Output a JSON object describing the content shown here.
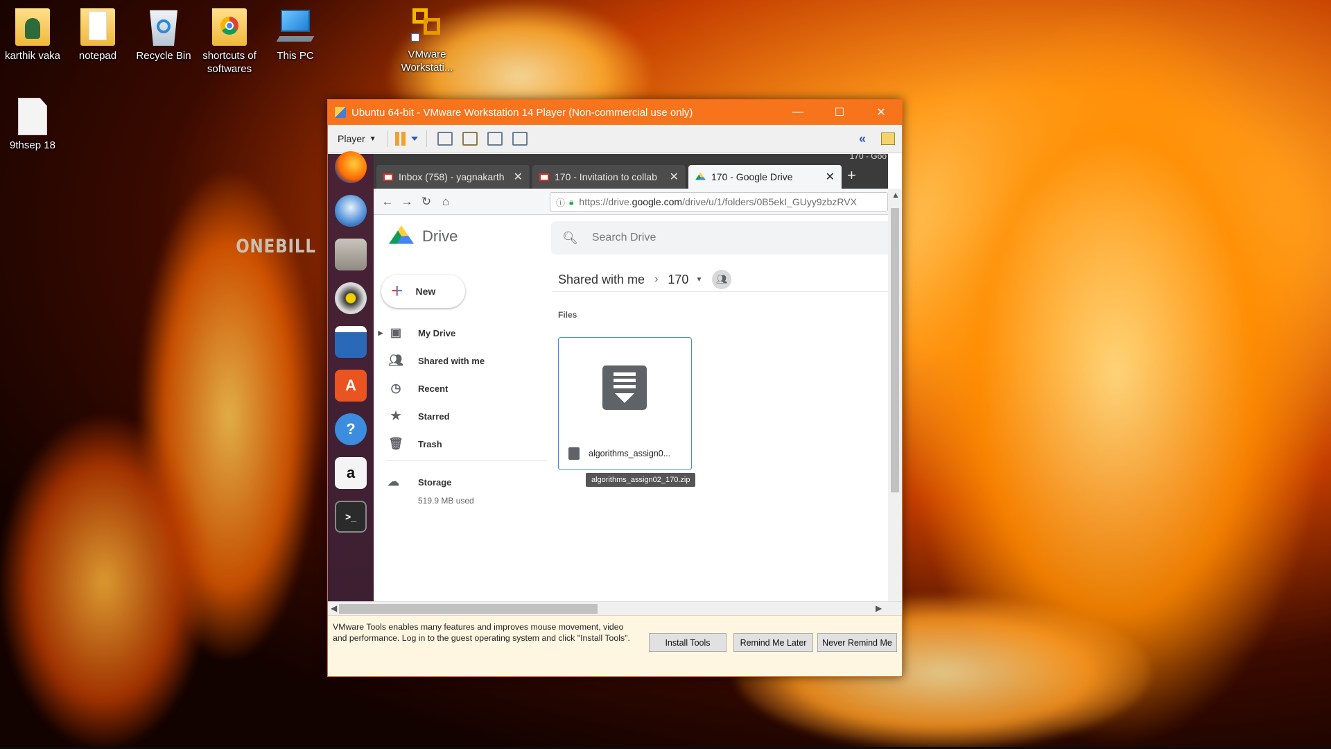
{
  "desktop": {
    "icons": [
      {
        "label": "karthik vaka",
        "icon": "user-folder-icon"
      },
      {
        "label": "notepad",
        "icon": "folder-icon"
      },
      {
        "label": "Recycle Bin",
        "icon": "recycle-bin-icon"
      },
      {
        "label": "shortcuts of softwares",
        "icon": "chrome-folder-icon"
      },
      {
        "label": "This PC",
        "icon": "computer-icon"
      },
      {
        "label": "VMware Workstati...",
        "icon": "vmware-icon"
      },
      {
        "label": "9thsep 18",
        "icon": "document-icon"
      }
    ],
    "wallpaper_text": "ONEBILL"
  },
  "vm_window": {
    "title": "Ubuntu 64-bit - VMware Workstation 14 Player (Non-commercial use only)",
    "controls": {
      "minimize": "—",
      "maximize": "☐",
      "close": "✕"
    },
    "toolbar": {
      "player_label": "Player"
    }
  },
  "browser": {
    "corner_text": "170 - Goo",
    "tabs": [
      {
        "label": "Inbox (758) - yagnakarth",
        "icon": "gmail-icon"
      },
      {
        "label": "170 - Invitation to collab",
        "icon": "gmail-icon"
      },
      {
        "label": "170 - Google Drive",
        "icon": "drive-icon",
        "active": true
      }
    ],
    "new_tab": "+",
    "url": {
      "prefix": "https://drive.",
      "host": "google.com",
      "path": "/drive/u/1/folders/0B5ekI_GUyy9zbzRVX"
    }
  },
  "drive": {
    "brand": "Drive",
    "search_placeholder": "Search Drive",
    "new_label": "New",
    "nav": [
      {
        "label": "My Drive",
        "icon": "my-drive-icon"
      },
      {
        "label": "Shared with me",
        "icon": "people-icon"
      },
      {
        "label": "Recent",
        "icon": "clock-icon"
      },
      {
        "label": "Starred",
        "icon": "star-icon"
      },
      {
        "label": "Trash",
        "icon": "trash-icon"
      }
    ],
    "storage_label": "Storage",
    "storage_used": "519.9 MB used",
    "breadcrumb": {
      "root": "Shared with me",
      "folder": "170"
    },
    "section_label": "Files",
    "file": {
      "name": "algorithms_assign0...",
      "tooltip": "algorithms_assign02_170.zip"
    }
  },
  "vmware_tools_bar": {
    "message": "VMware Tools enables many features and improves mouse movement, video and performance. Log in to the guest operating system and click \"Install Tools\".",
    "buttons": [
      "Install Tools",
      "Remind Me Later",
      "Never Remind Me"
    ]
  },
  "colors": {
    "titlebar": "#f7741d",
    "launcher": "#4a2236",
    "drive_selection": "#4285f4"
  }
}
